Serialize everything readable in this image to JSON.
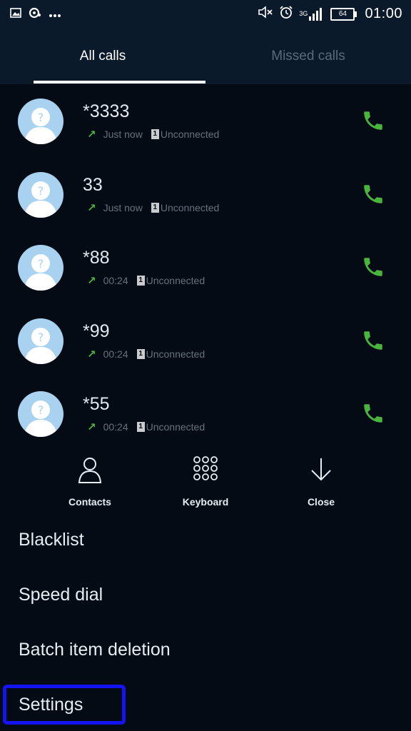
{
  "status_bar": {
    "time": "01:00",
    "battery": "64",
    "network": "3G",
    "icons": [
      "image-icon",
      "sync-icon",
      "more-dots-icon",
      "mute-icon",
      "alarm-icon",
      "signal-icon",
      "battery-icon"
    ]
  },
  "tabs": [
    {
      "label": "All calls",
      "active": true
    },
    {
      "label": "Missed calls",
      "active": false
    }
  ],
  "calls": [
    {
      "number": "*3333",
      "time": "Just now",
      "sim": "1",
      "status": "Unconnected",
      "direction": "outgoing"
    },
    {
      "number": "33",
      "time": "Just now",
      "sim": "1",
      "status": "Unconnected",
      "direction": "outgoing"
    },
    {
      "number": "*88",
      "time": "00:24",
      "sim": "1",
      "status": "Unconnected",
      "direction": "outgoing"
    },
    {
      "number": "*99",
      "time": "00:24",
      "sim": "1",
      "status": "Unconnected",
      "direction": "outgoing"
    },
    {
      "number": "*55",
      "time": "00:24",
      "sim": "1",
      "status": "Unconnected",
      "direction": "outgoing"
    }
  ],
  "actions": {
    "contacts": "Contacts",
    "keyboard": "Keyboard",
    "close": "Close"
  },
  "menu": {
    "blacklist": "Blacklist",
    "speed_dial": "Speed dial",
    "batch_delete": "Batch item deletion",
    "settings": "Settings"
  },
  "colors": {
    "background": "#040b14",
    "header": "#0b1a2b",
    "accent_green": "#4ab53c",
    "avatar": "#a9d2f1",
    "highlight": "#1414f2"
  }
}
